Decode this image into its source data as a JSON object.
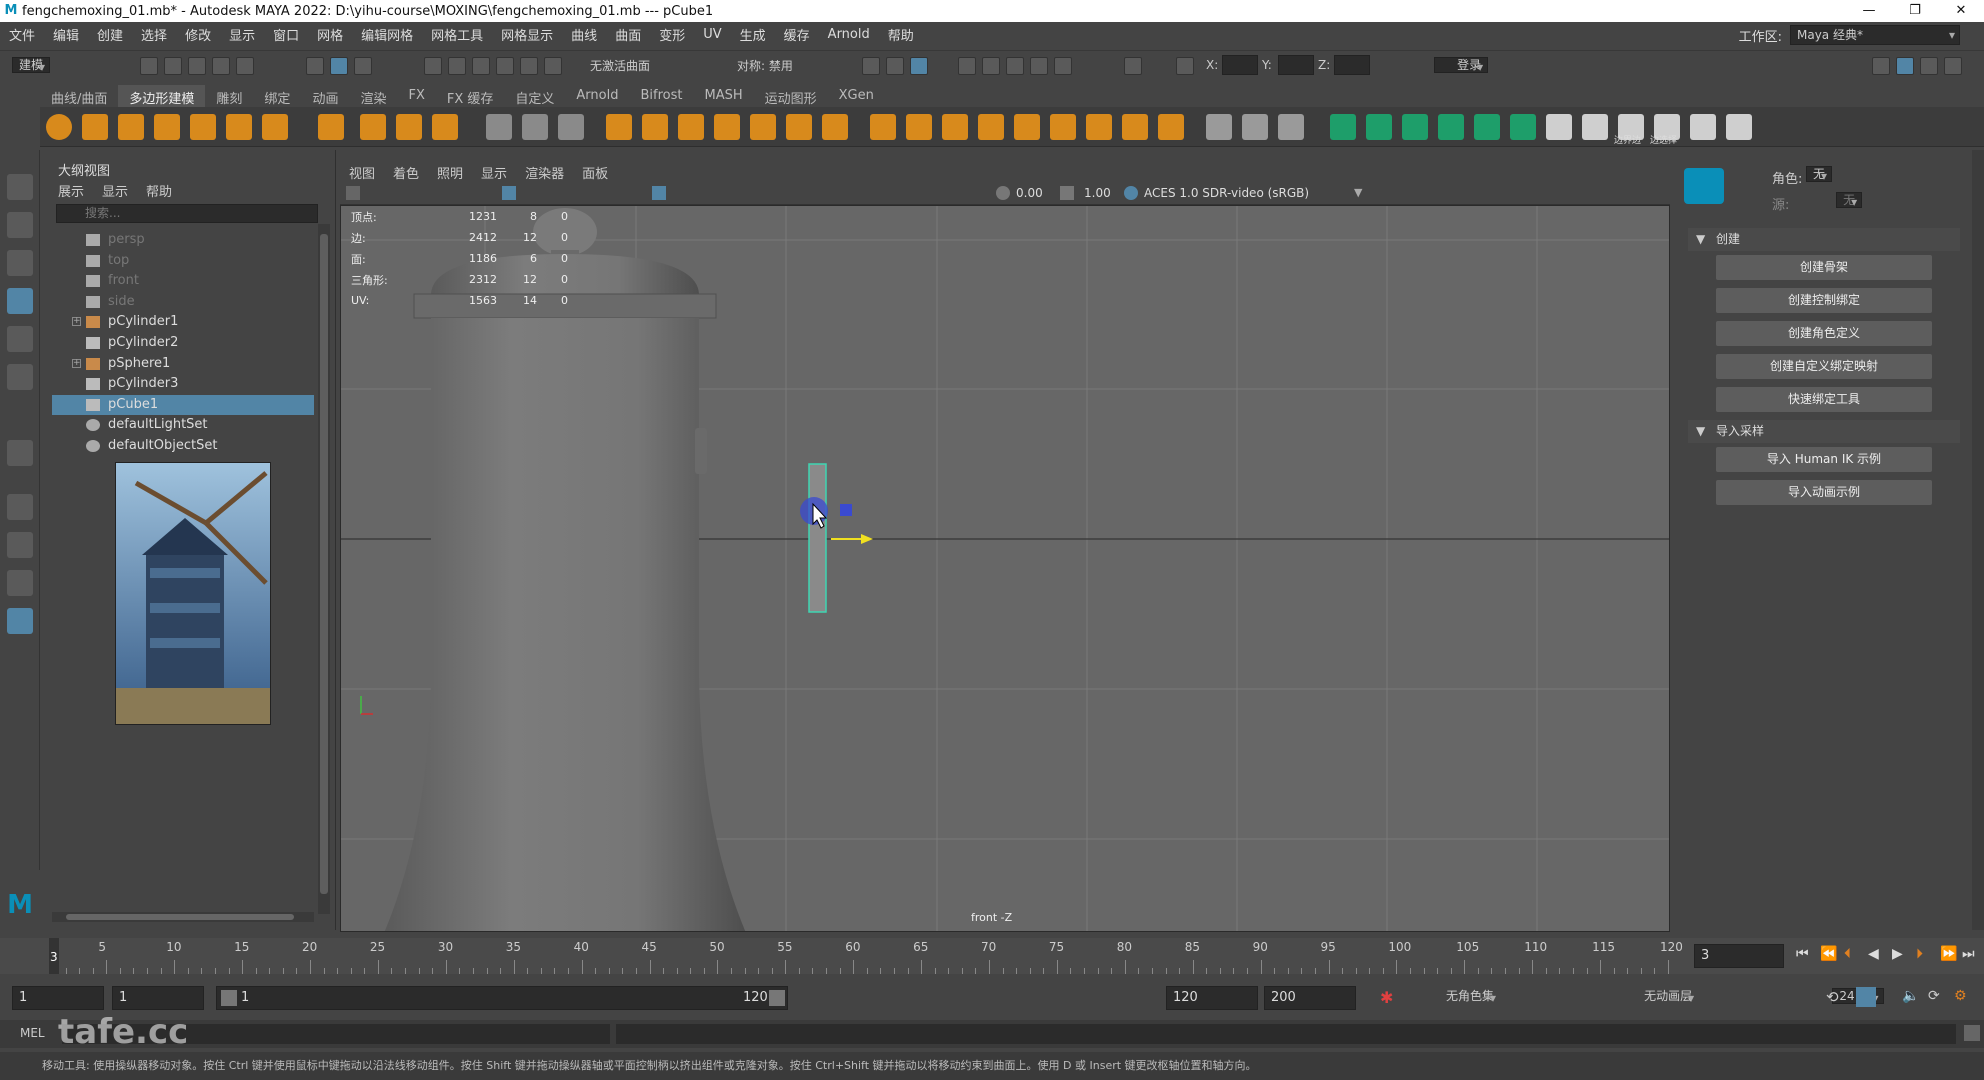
{
  "title_bar": {
    "app_logo": "M",
    "title": "fengchemoxing_01.mb* - Autodesk MAYA 2022: D:\\yihu-course\\MOXING\\fengchemoxing_01.mb   ---   pCube1",
    "minimize": "—",
    "maximize": "❐",
    "close": "✕"
  },
  "menu_bar": {
    "items": [
      "文件",
      "编辑",
      "创建",
      "选择",
      "修改",
      "显示",
      "窗口",
      "网格",
      "编辑网格",
      "网格工具",
      "网格显示",
      "曲线",
      "曲面",
      "变形",
      "UV",
      "生成",
      "缓存",
      "Arnold",
      "帮助"
    ],
    "workspace_label": "工作区:",
    "workspace_value": "Maya 经典*"
  },
  "status_line": {
    "mode_menu": "建模",
    "live_surface": "无激活曲面",
    "symmetry": "对称: 禁用",
    "x_label": "X:",
    "y_label": "Y:",
    "z_label": "Z:",
    "login": "登录"
  },
  "shelf": {
    "tabs": [
      "曲线/曲面",
      "多边形建模",
      "雕刻",
      "绑定",
      "动画",
      "渲染",
      "FX",
      "FX 缓存",
      "自定义",
      "Arnold",
      "Bifrost",
      "MASH",
      "运动图形",
      "XGen"
    ],
    "active_tab": 1,
    "label_a": "边界边",
    "label_b": "边选择"
  },
  "outliner": {
    "title": "大纲视图",
    "menu": [
      "展示",
      "显示",
      "帮助"
    ],
    "search_placeholder": "搜索...",
    "items": [
      {
        "label": "persp",
        "kind": "camera",
        "dim": true,
        "expand": false
      },
      {
        "label": "top",
        "kind": "camera",
        "dim": true,
        "expand": false
      },
      {
        "label": "front",
        "kind": "camera",
        "dim": true,
        "expand": false
      },
      {
        "label": "side",
        "kind": "camera",
        "dim": true,
        "expand": false
      },
      {
        "label": "pCylinder1",
        "kind": "group",
        "dim": false,
        "expand": true
      },
      {
        "label": "pCylinder2",
        "kind": "mesh",
        "dim": false,
        "expand": false
      },
      {
        "label": "pSphere1",
        "kind": "group",
        "dim": false,
        "expand": true
      },
      {
        "label": "pCylinder3",
        "kind": "mesh",
        "dim": false,
        "expand": false
      },
      {
        "label": "pCube1",
        "kind": "mesh",
        "dim": false,
        "expand": false,
        "selected": true
      },
      {
        "label": "defaultLightSet",
        "kind": "set",
        "dim": false,
        "expand": false
      },
      {
        "label": "defaultObjectSet",
        "kind": "set",
        "dim": false,
        "expand": false
      }
    ]
  },
  "viewport": {
    "menu": [
      "视图",
      "着色",
      "照明",
      "显示",
      "渲染器",
      "面板"
    ],
    "exposure": "0.00",
    "gamma": "1.00",
    "color_space": "ACES 1.0 SDR-video (sRGB)",
    "hud": [
      {
        "label": "顶点:",
        "a": "1231",
        "b": "8",
        "c": "0"
      },
      {
        "label": "边:",
        "a": "2412",
        "b": "12",
        "c": "0"
      },
      {
        "label": "面:",
        "a": "1186",
        "b": "6",
        "c": "0"
      },
      {
        "label": "三角形:",
        "a": "2312",
        "b": "12",
        "c": "0"
      },
      {
        "label": "UV:",
        "a": "1563",
        "b": "14",
        "c": "0"
      }
    ],
    "camera_label": "front -Z"
  },
  "right_panel": {
    "character_label": "角色:",
    "character_value": "无",
    "source_label": "源:",
    "source_value": "无",
    "sections": [
      {
        "title": "创建",
        "buttons": [
          "创建骨架",
          "创建控制绑定",
          "创建角色定义",
          "创建自定义绑定映射",
          "快速绑定工具"
        ]
      },
      {
        "title": "导入采样",
        "buttons": [
          "导入 Human IK 示例",
          "导入动画示例"
        ]
      }
    ]
  },
  "timeline": {
    "ticks": [
      "5",
      "10",
      "15",
      "20",
      "25",
      "30",
      "35",
      "40",
      "45",
      "50",
      "55",
      "60",
      "65",
      "70",
      "75",
      "80",
      "85",
      "90",
      "95",
      "100",
      "105",
      "110",
      "115",
      "120"
    ],
    "current_frame": "3",
    "frame_field": "3"
  },
  "range_bar": {
    "start": "1",
    "playback_start": "1",
    "slider_start": "1",
    "slider_end": "120",
    "playback_end": "120",
    "end": "200",
    "character_set": "无角色集",
    "anim_layer": "无动画层",
    "fps": "24 fps"
  },
  "command_line": {
    "lang": "MEL",
    "watermark": "tafe.cc"
  },
  "help_line": {
    "text": "移动工具: 使用操纵器移动对象。按住 Ctrl 键并使用鼠标中键拖动以沿法线移动组件。按住 Shift 键并拖动操纵器轴或平面控制柄以挤出组件或克隆对象。按住 Ctrl+Shift 键并拖动以将移动约束到曲面上。使用 D 或 Insert 键更改枢轴位置和轴方向。"
  },
  "colors": {
    "selection": "#5285a6",
    "maya_teal": "#0a8fb8",
    "shelf_green": "#1e9e6a",
    "shelf_orange": "#d88a1c"
  }
}
